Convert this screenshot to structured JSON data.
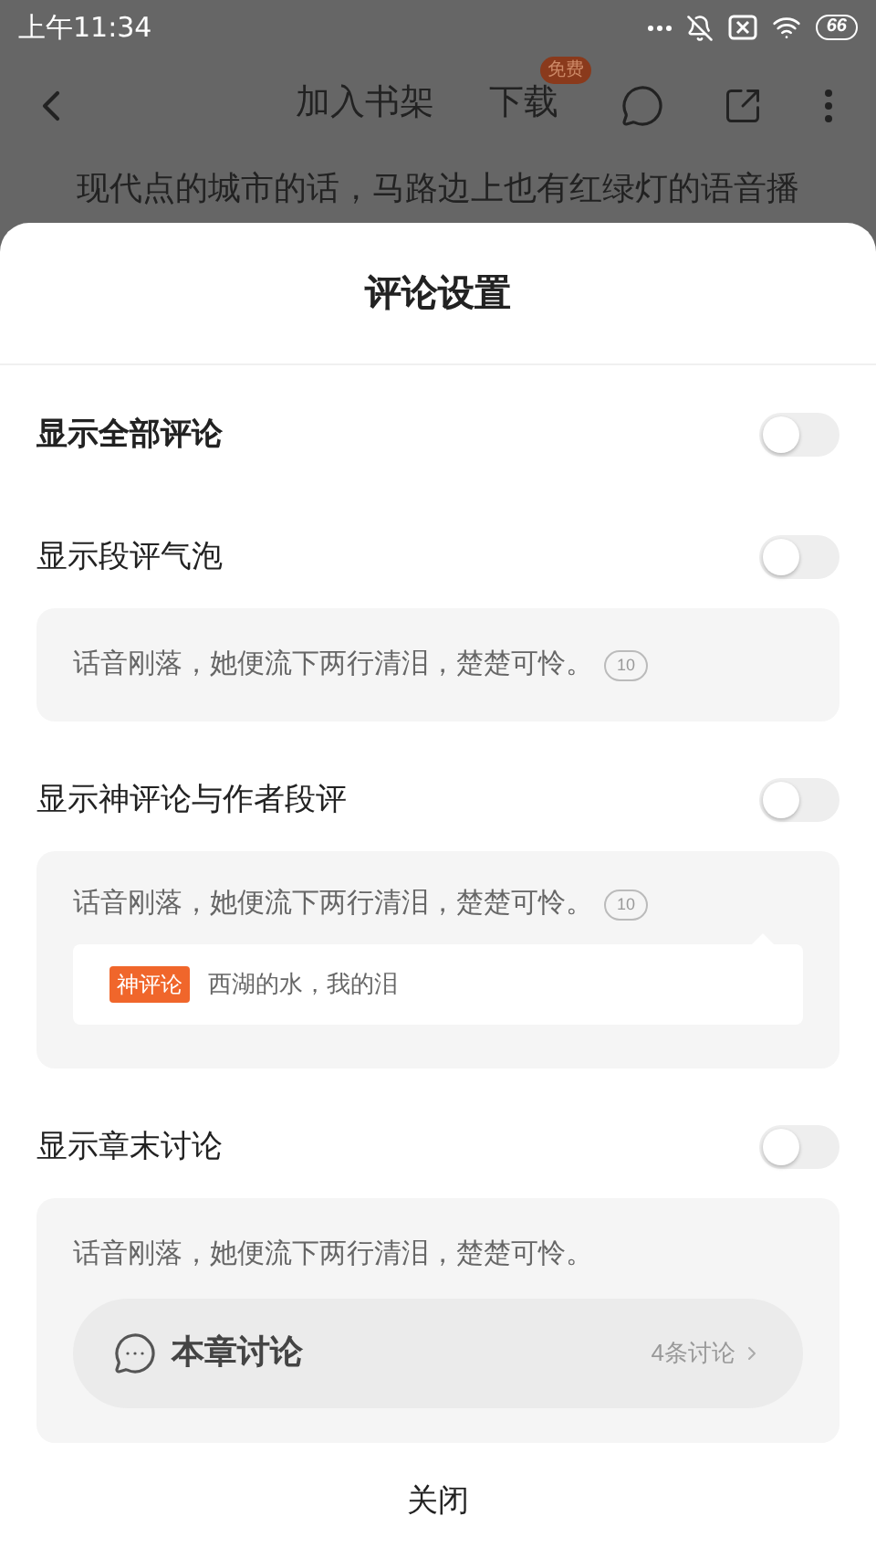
{
  "status_bar": {
    "time": "上午11:34",
    "battery": "66"
  },
  "toolbar": {
    "add_to_shelf": "加入书架",
    "download": "下载",
    "download_badge": "免费"
  },
  "background_text": "现代点的城市的话，马路边上也有红绿灯的语音播",
  "sheet": {
    "title": "评论设置",
    "sections": [
      {
        "label": "显示全部评论",
        "on": false,
        "preview": {
          "kind": "none"
        }
      },
      {
        "label": "显示段评气泡",
        "on": false,
        "preview": {
          "kind": "bubble",
          "text": "话音刚落，她便流下两行清泪，楚楚可怜。",
          "bubble_count": "10"
        }
      },
      {
        "label": "显示神评论与作者段评",
        "on": false,
        "preview": {
          "kind": "god_comment",
          "text": "话音刚落，她便流下两行清泪，楚楚可怜。",
          "bubble_count": "10",
          "tag": "神评论",
          "comment": "西湖的水，我的泪"
        }
      },
      {
        "label": "显示章末讨论",
        "on": false,
        "preview": {
          "kind": "chapter_discussion",
          "text": "话音刚落，她便流下两行清泪，楚楚可怜。",
          "discussion_title": "本章讨论",
          "discussion_count": "4条讨论"
        }
      }
    ],
    "close": "关闭"
  }
}
